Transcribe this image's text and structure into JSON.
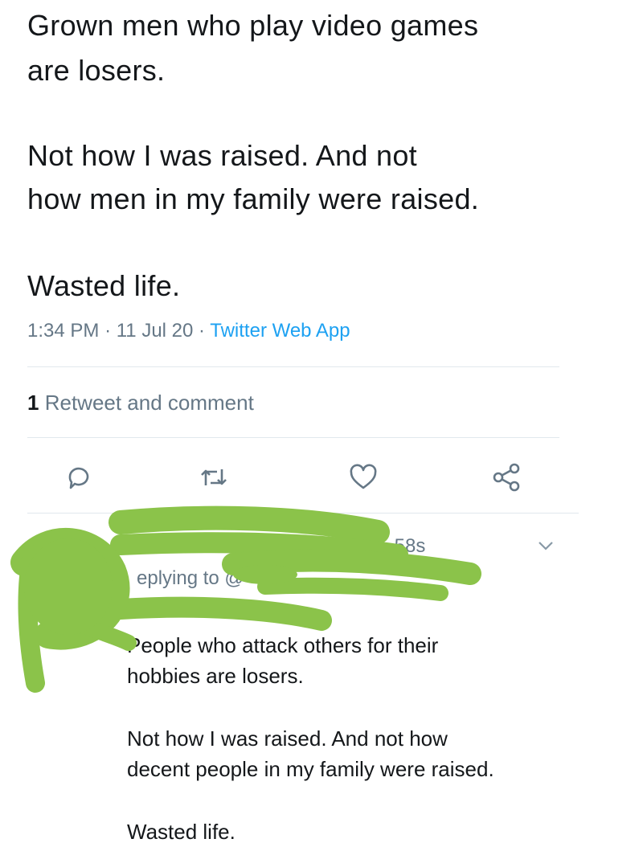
{
  "tweet": {
    "lines": [
      "Grown men who play video games",
      "are losers.",
      "Not how I was raised. And not",
      "how men in my family were raised.",
      "Wasted life."
    ],
    "time": "1:34 PM",
    "date": "11 Jul 20",
    "source": "Twitter Web App",
    "stats": {
      "count": "1",
      "label": "Retweet and comment"
    }
  },
  "actions": {
    "reply_icon": "speech-bubble-icon",
    "retweet_icon": "retweet-icon",
    "like_icon": "heart-icon",
    "share_icon": "share-icon"
  },
  "reply": {
    "timestamp": "· 58s",
    "replying_to": "eplying to @",
    "lines": [
      "People who attack others for their",
      "hobbies are losers.",
      "Not how I was raised. And not how",
      "decent people in my family were raised.",
      "Wasted life."
    ],
    "redaction_color": "#8bc34a",
    "caret_icon": "chevron-down-icon"
  }
}
